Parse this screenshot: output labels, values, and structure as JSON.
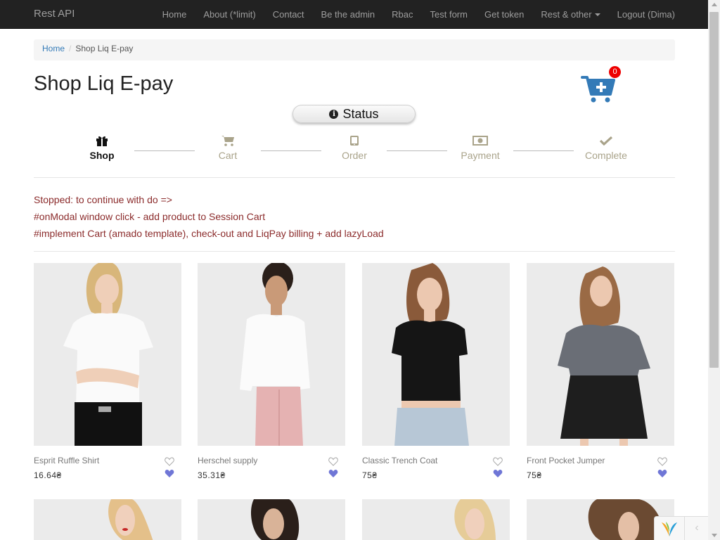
{
  "navbar": {
    "brand": "Rest API",
    "items": [
      {
        "label": "Home"
      },
      {
        "label": "About (*limit)"
      },
      {
        "label": "Contact"
      },
      {
        "label": "Be the admin"
      },
      {
        "label": "Rbac"
      },
      {
        "label": "Test form"
      },
      {
        "label": "Get token"
      },
      {
        "label": "Rest & other"
      },
      {
        "label": "Logout (Dima)"
      }
    ]
  },
  "breadcrumb": {
    "home": "Home",
    "current": "Shop Liq E-pay"
  },
  "page": {
    "title": "Shop Liq E-pay"
  },
  "cart": {
    "icon": "cart-plus-icon",
    "count": "0",
    "color": "#337ab7",
    "badge_color": "#e00000"
  },
  "status": {
    "label": "Status",
    "icon": "info-circle-icon"
  },
  "steps": [
    {
      "label": "Shop",
      "icon": "gift-icon",
      "active": true
    },
    {
      "label": "Cart",
      "icon": "cart-icon",
      "active": false
    },
    {
      "label": "Order",
      "icon": "tablet-icon",
      "active": false
    },
    {
      "label": "Payment",
      "icon": "money-icon",
      "active": false
    },
    {
      "label": "Complete",
      "icon": "check-icon",
      "active": false
    }
  ],
  "notes": [
    "Stopped: to continue with do =>",
    "#onModal window click - add product to Session Cart",
    "#implement Cart (amado template), check-out and LiqPay billing + add lazyLoad"
  ],
  "products": [
    {
      "name": "Esprit Ruffle Shirt",
      "price": "16.64₴"
    },
    {
      "name": "Herschel supply",
      "price": "35.31₴"
    },
    {
      "name": "Classic Trench Coat",
      "price": "75₴"
    },
    {
      "name": "Front Pocket Jumper",
      "price": "75₴"
    }
  ],
  "colors": {
    "navbar_bg": "#222222",
    "note_text": "#8b2b2b",
    "heart": "#6f76d6"
  }
}
